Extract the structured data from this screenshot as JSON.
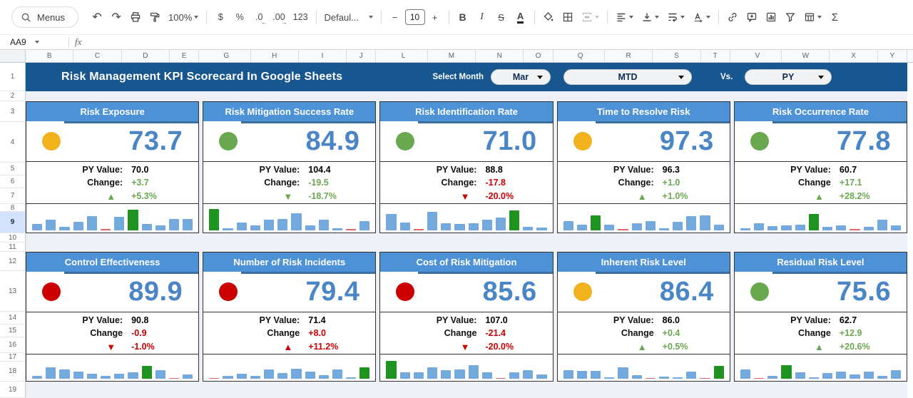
{
  "toolbar": {
    "menus_label": "Menus",
    "zoom_value": "100%",
    "currency": "$",
    "percent": "%",
    "decrease_decimals": ".0",
    "increase_decimals": ".00",
    "more_formats": "123",
    "font_name": "Defaul...",
    "decrease_font": "−",
    "font_size": "10",
    "increase_font": "+",
    "bold": "B",
    "italic": "I",
    "strikethrough": "S",
    "text_color": "A",
    "functions": "Σ"
  },
  "icons": {
    "undo": "↶",
    "redo": "↷",
    "triangle_up": "▲",
    "triangle_down": "▼",
    "arrow_left_small": "←",
    "arrow_right_small": "→"
  },
  "formula_bar": {
    "cell_reference": "AA9",
    "fx_label": "fx"
  },
  "header": {
    "title": "Risk Management KPI Scorecard In Google Sheets",
    "select_month_label": "Select Month",
    "month": "Mar",
    "period": "MTD",
    "vs_label": "Vs.",
    "compare": "PY"
  },
  "grid": {
    "column_groups": [
      [
        "B",
        "C",
        "D",
        "E"
      ],
      [
        "G",
        "H",
        "I",
        "J"
      ],
      [
        "L",
        "M",
        "N",
        "O"
      ],
      [
        "Q",
        "R",
        "S",
        "T"
      ],
      [
        "V",
        "W",
        "X",
        "Y"
      ]
    ],
    "row_numbers": [
      "1",
      "2",
      "3",
      "4",
      "5",
      "6",
      "7",
      "8",
      "9",
      "10",
      "11",
      "12",
      "13",
      "14",
      "15",
      "16",
      "17",
      "18",
      "19"
    ],
    "selected_row": "9"
  },
  "colors": {
    "navy": "#17568f",
    "card_header_blue": "#4d92d6",
    "value_blue": "#4a85c6",
    "green": "#6aa84f",
    "red": "#cc0000",
    "yellow": "#f2b21d",
    "spark_blue": "#74a9dd",
    "spark_green": "#1e9320",
    "spark_red": "#e06666",
    "row_highlight": "#d3e3fd",
    "band_bg": "#edf0f4"
  },
  "cards": [
    {
      "title": "Risk Exposure",
      "status": "yellow",
      "value": "73.7",
      "py_label": "PY Value:",
      "py_value": "70.0",
      "change_label": "Change:",
      "change_value": "+3.7",
      "change_color": "green",
      "trend": "up",
      "change_percent": "+5.3%",
      "percent_color": "green",
      "spark": {
        "v": [
          28,
          45,
          15,
          35,
          62,
          5,
          58,
          88,
          28,
          22,
          48,
          48
        ],
        "c": [
          "b",
          "b",
          "b",
          "b",
          "b",
          "r",
          "b",
          "g",
          "b",
          "b",
          "b",
          "b"
        ]
      }
    },
    {
      "title": "Risk Mitigation Success Rate",
      "status": "green",
      "value": "84.9",
      "py_label": "PY Value:",
      "py_value": "104.4",
      "change_label": "Change:",
      "change_value": "-19.5",
      "change_color": "green",
      "trend": "down",
      "change_percent": "-18.7%",
      "percent_color": "green",
      "spark": {
        "v": [
          90,
          8,
          33,
          20,
          45,
          50,
          73,
          20,
          45,
          8,
          5,
          40
        ],
        "c": [
          "g",
          "b",
          "b",
          "b",
          "b",
          "b",
          "b",
          "b",
          "b",
          "b",
          "r",
          "b"
        ]
      }
    },
    {
      "title": "Risk Identification Rate",
      "status": "green",
      "value": "71.0",
      "py_label": "PY Value:",
      "py_value": "88.8",
      "change_label": "Change:",
      "change_value": "-17.8",
      "change_color": "red",
      "trend": "down",
      "change_percent": "-20.0%",
      "percent_color": "red",
      "spark": {
        "v": [
          70,
          32,
          5,
          80,
          30,
          28,
          30,
          45,
          55,
          85,
          15,
          12
        ],
        "c": [
          "b",
          "b",
          "r",
          "b",
          "b",
          "b",
          "b",
          "b",
          "b",
          "g",
          "b",
          "b"
        ]
      }
    },
    {
      "title": "Time to Resolve Risk",
      "status": "yellow",
      "value": "97.3",
      "py_label": "PY Value:",
      "py_value": "96.3",
      "change_label": "Change:",
      "change_value": "+1.0",
      "change_color": "green",
      "trend": "up",
      "change_percent": "+1.0%",
      "percent_color": "green",
      "spark": {
        "v": [
          40,
          25,
          65,
          25,
          5,
          30,
          40,
          10,
          35,
          62,
          65,
          25
        ],
        "c": [
          "b",
          "b",
          "g",
          "b",
          "r",
          "b",
          "b",
          "b",
          "b",
          "b",
          "b",
          "b"
        ]
      }
    },
    {
      "title": "Risk Occurrence Rate",
      "status": "green",
      "value": "77.8",
      "py_label": "PY Value:",
      "py_value": "60.7",
      "change_label": "Change",
      "change_value": "+17.1",
      "change_color": "green",
      "trend": "up",
      "change_percent": "+28.2%",
      "percent_color": "green",
      "spark": {
        "v": [
          10,
          30,
          18,
          22,
          25,
          70,
          15,
          20,
          5,
          15,
          45,
          20
        ],
        "c": [
          "b",
          "b",
          "b",
          "b",
          "b",
          "g",
          "b",
          "b",
          "r",
          "b",
          "b",
          "b"
        ]
      }
    },
    {
      "title": "Control Effectiveness",
      "status": "red",
      "value": "89.9",
      "py_label": "PY Value:",
      "py_value": "90.8",
      "change_label": "Change",
      "change_value": "-0.9",
      "change_color": "red",
      "trend": "down",
      "change_percent": "-1.0%",
      "percent_color": "red",
      "spark": {
        "v": [
          12,
          55,
          45,
          35,
          25,
          15,
          22,
          30,
          60,
          40,
          5,
          20
        ],
        "c": [
          "b",
          "b",
          "b",
          "b",
          "b",
          "b",
          "b",
          "b",
          "g",
          "b",
          "r",
          "b"
        ]
      }
    },
    {
      "title": "Number of Risk Incidents",
      "status": "red",
      "value": "79.4",
      "py_label": "PY Value:",
      "py_value": "71.4",
      "change_label": "Change",
      "change_value": "+8.0",
      "change_color": "red",
      "trend": "up",
      "change_percent": "+11.2%",
      "percent_color": "red",
      "spark": {
        "v": [
          5,
          15,
          22,
          12,
          42,
          28,
          48,
          35,
          18,
          45,
          8,
          55
        ],
        "c": [
          "r",
          "b",
          "b",
          "b",
          "b",
          "b",
          "b",
          "b",
          "b",
          "b",
          "b",
          "g"
        ]
      }
    },
    {
      "title": "Cost of Risk Mitigation",
      "status": "red",
      "value": "85.6",
      "py_label": "PY Value:",
      "py_value": "107.0",
      "change_label": "Change",
      "change_value": "-21.4",
      "change_color": "red",
      "trend": "down",
      "change_percent": "-20.0%",
      "percent_color": "red",
      "spark": {
        "v": [
          85,
          30,
          30,
          55,
          40,
          45,
          65,
          30,
          5,
          30,
          40,
          20
        ],
        "c": [
          "g",
          "b",
          "b",
          "b",
          "b",
          "b",
          "b",
          "b",
          "r",
          "b",
          "b",
          "b"
        ]
      }
    },
    {
      "title": "Inherent Risk Level",
      "status": "yellow",
      "value": "86.4",
      "py_label": "PY Value:",
      "py_value": "86.0",
      "change_label": "Change",
      "change_value": "+0.4",
      "change_color": "green",
      "trend": "up",
      "change_percent": "+0.5%",
      "percent_color": "green",
      "spark": {
        "v": [
          40,
          38,
          38,
          8,
          55,
          18,
          5,
          10,
          8,
          35,
          5,
          60
        ],
        "c": [
          "b",
          "b",
          "b",
          "b",
          "b",
          "b",
          "r",
          "b",
          "b",
          "b",
          "r",
          "g"
        ]
      }
    },
    {
      "title": "Residual Risk Level",
      "status": "green",
      "value": "75.6",
      "py_label": "PY Value:",
      "py_value": "62.7",
      "change_label": "Change",
      "change_value": "+12.9",
      "change_color": "green",
      "trend": "up",
      "change_percent": "+20.6%",
      "percent_color": "green",
      "spark": {
        "v": [
          45,
          5,
          12,
          65,
          30,
          8,
          28,
          35,
          20,
          33,
          15,
          40
        ],
        "c": [
          "b",
          "r",
          "b",
          "g",
          "b",
          "b",
          "b",
          "b",
          "b",
          "b",
          "b",
          "b"
        ]
      }
    }
  ]
}
